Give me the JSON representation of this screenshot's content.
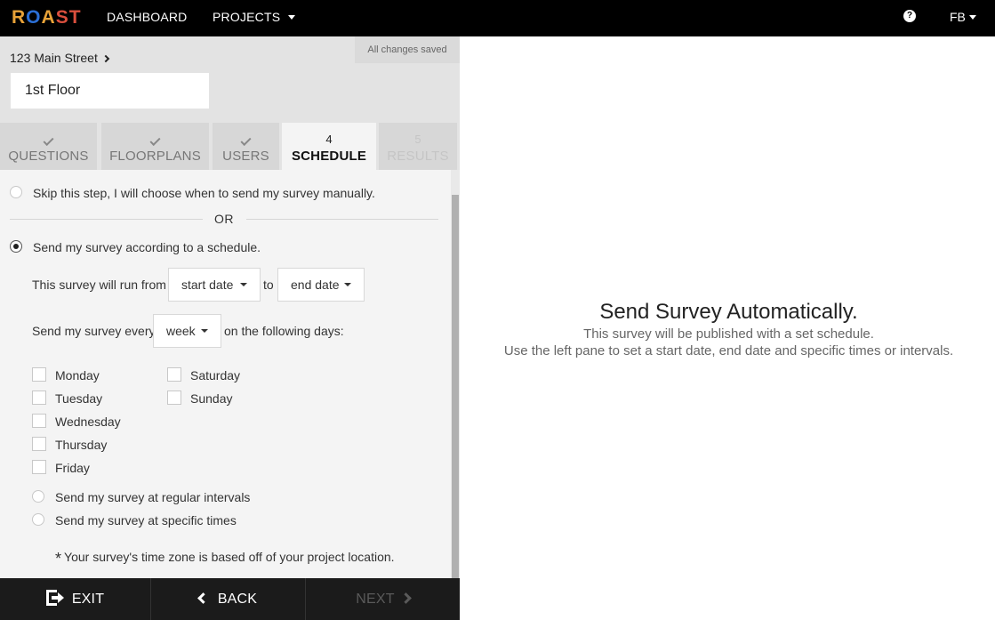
{
  "nav": {
    "logo": "ROAST",
    "dashboard": "DASHBOARD",
    "projects": "PROJECTS",
    "help_icon": "question-circle",
    "user_initials": "FB"
  },
  "header": {
    "saved_status": "All changes saved",
    "breadcrumb": "123 Main Street",
    "floor_value": "1st Floor"
  },
  "tabs": [
    {
      "mark": "check",
      "label": "QUESTIONS"
    },
    {
      "mark": "check",
      "label": "FLOORPLANS"
    },
    {
      "mark": "check",
      "label": "USERS"
    },
    {
      "mark": "4",
      "label": "SCHEDULE",
      "active": true
    },
    {
      "mark": "5",
      "label": "RESULTS",
      "disabled": true
    }
  ],
  "form": {
    "skip_option": "Skip this step, I will choose when to send my survey manually.",
    "or": "OR",
    "schedule_option": "Send my survey according to a schedule.",
    "run_from": "This survey will run from",
    "start_date": "start date",
    "to": "to",
    "end_date": "end date",
    "send_every": "Send my survey every",
    "period": "week",
    "following_days": "on the following days:",
    "days": [
      "Monday",
      "Tuesday",
      "Wednesday",
      "Thursday",
      "Friday",
      "Saturday",
      "Sunday"
    ],
    "interval_option": "Send my survey at regular intervals",
    "times_option": "Send my survey at specific times",
    "timezone_note_mark": "*",
    "timezone_note": "Your survey's time zone is based off of your project location."
  },
  "footer": {
    "exit": "EXIT",
    "back": "BACK",
    "next": "NEXT"
  },
  "info": {
    "title": "Send Survey Automatically.",
    "line1": "This survey will be published with a set schedule.",
    "line2": "Use the left pane to set a start date, end date and specific times or intervals."
  }
}
